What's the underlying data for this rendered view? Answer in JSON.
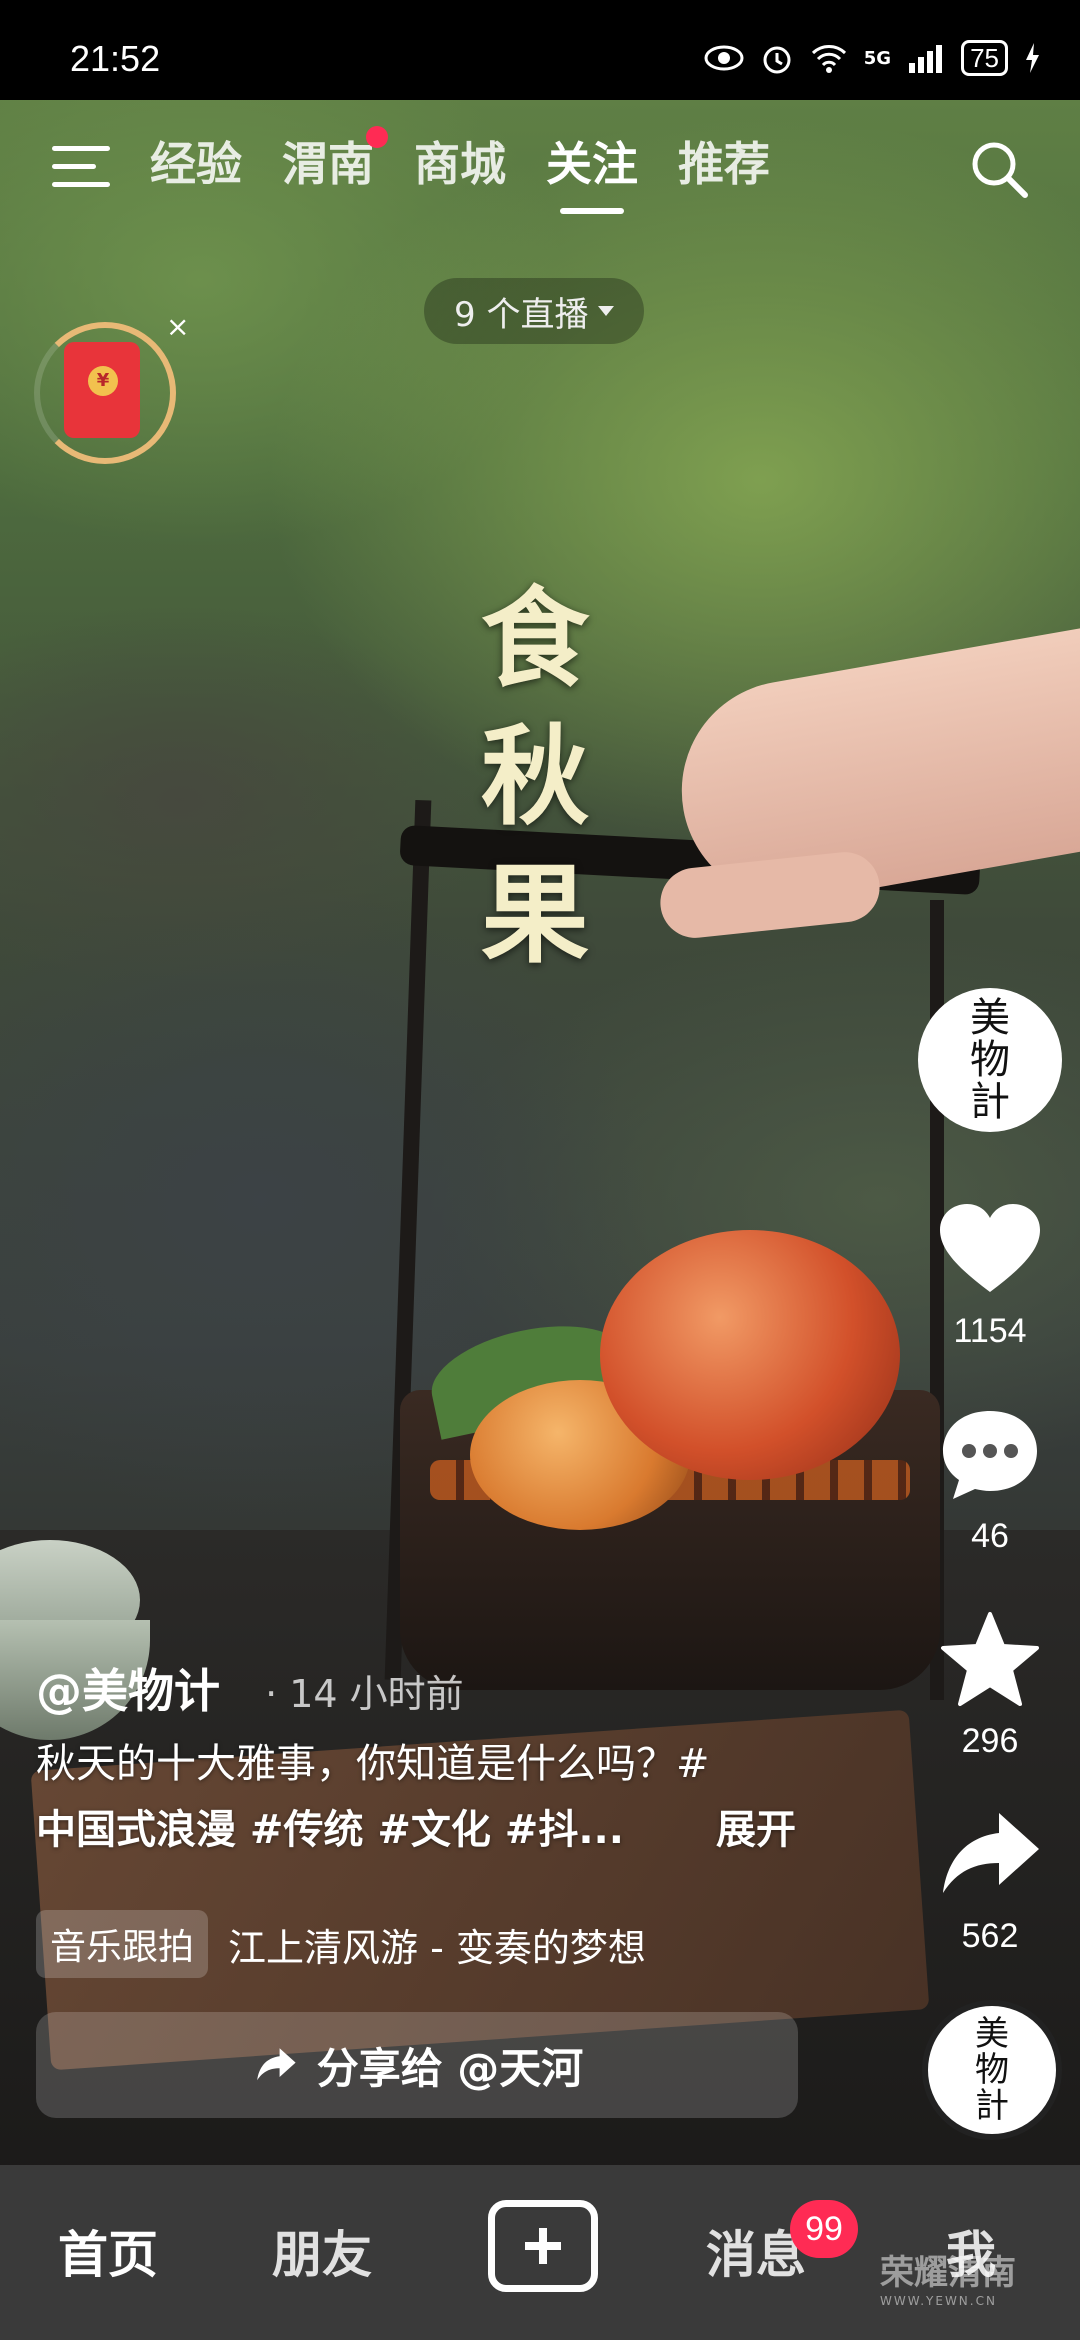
{
  "status_bar": {
    "time": "21:52",
    "battery": "75",
    "network": "5G"
  },
  "top_nav": {
    "tabs": [
      "经验",
      "渭南",
      "商城",
      "关注",
      "推荐"
    ],
    "active_tab": "关注"
  },
  "live": {
    "label": "9 个直播"
  },
  "video": {
    "title_chars": [
      "食",
      "秋",
      "果"
    ]
  },
  "right_rail": {
    "avatar_text": [
      "美",
      "物",
      "計"
    ],
    "likes": "1154",
    "comments": "46",
    "favorites": "296",
    "shares": "562"
  },
  "post": {
    "author": "@美物计",
    "time": "· 14 小时前",
    "desc_line1": "秋天的十大雅事，你知道是什么吗？#",
    "desc_line2_tags": "中国式浪漫 #传统 #文化 #抖...",
    "expand": "展开",
    "music_tag": "音乐跟拍",
    "music_title": "江上清风游 - 变奏的梦想",
    "share_label": "分享给 @天河"
  },
  "bottom_nav": {
    "home": "首页",
    "friends": "朋友",
    "messages": "消息",
    "messages_badge": "99",
    "me": "我"
  },
  "watermark": {
    "text": "荣耀渭南",
    "sub": "WWW.YEWN.CN"
  },
  "colors": {
    "accent_red": "#ff2b54",
    "title_cream": "#f4eec8",
    "nav_bg": "#3a3a3a"
  },
  "icons": [
    "menu-icon",
    "search-icon",
    "heart-icon",
    "comment-icon",
    "star-icon",
    "share-arrow-icon",
    "plus-icon",
    "red-envelope-icon"
  ]
}
